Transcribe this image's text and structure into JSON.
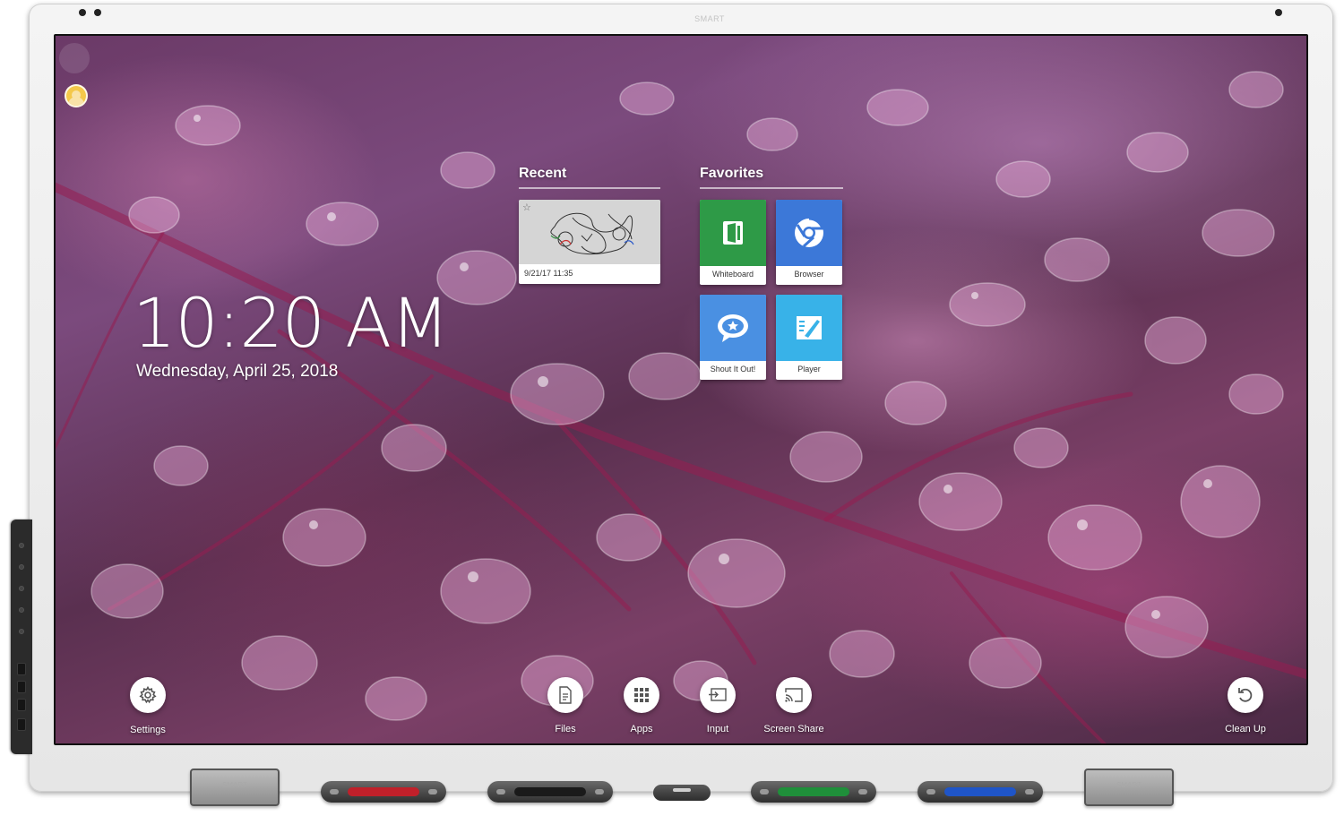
{
  "device": {
    "brand_top": "SMART"
  },
  "home": {
    "time": "10:20 AM",
    "date": "Wednesday, April 25, 2018"
  },
  "recent": {
    "title": "Recent",
    "items": [
      {
        "timestamp": "9/21/17 11:35"
      }
    ]
  },
  "favorites": {
    "title": "Favorites",
    "items": [
      {
        "label": "Whiteboard",
        "icon": "whiteboard-icon",
        "color": "#2e9a47"
      },
      {
        "label": "Browser",
        "icon": "browser-icon",
        "color": "#3c78d8"
      },
      {
        "label": "Shout It Out!",
        "icon": "shout-it-out-icon",
        "color": "#4a90e2"
      },
      {
        "label": "Player",
        "icon": "player-icon",
        "color": "#38b2e8"
      }
    ]
  },
  "dock": {
    "settings": "Settings",
    "files": "Files",
    "apps": "Apps",
    "input": "Input",
    "screen_share": "Screen Share",
    "clean_up": "Clean Up"
  },
  "pens": [
    {
      "color": "#c0202a"
    },
    {
      "color": "#1a1a1a"
    },
    {
      "color": "#1f8f3a"
    },
    {
      "color": "#1f55c8"
    }
  ],
  "colors": {
    "accent_white": "#ffffff",
    "wallpaper_tint": "#6b3a67"
  }
}
